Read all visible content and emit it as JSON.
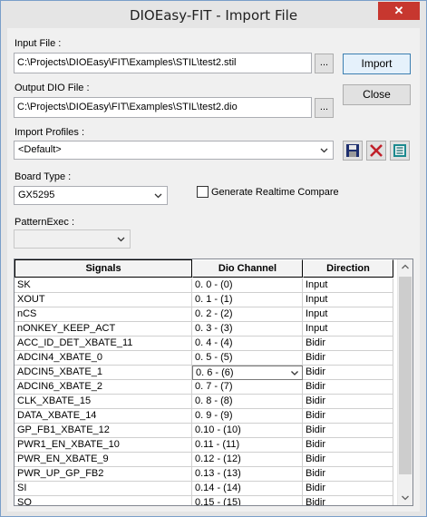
{
  "window": {
    "title": "DIOEasy-FIT - Import File",
    "close_glyph": "✕"
  },
  "input_file": {
    "label": "Input File :",
    "value": "C:\\Projects\\DIOEasy\\FIT\\Examples\\STIL\\test2.stil",
    "browse_label": "..."
  },
  "output_file": {
    "label": "Output DIO File :",
    "value": "C:\\Projects\\DIOEasy\\FIT\\Examples\\STIL\\test2.dio",
    "browse_label": "..."
  },
  "buttons": {
    "import": "Import",
    "close": "Close"
  },
  "profiles": {
    "label": "Import Profiles :",
    "value": "<Default>",
    "icons": [
      "save-icon",
      "delete-icon",
      "profile-list-icon"
    ]
  },
  "board_type": {
    "label": "Board Type :",
    "value": "GX5295"
  },
  "realtime": {
    "label": "Generate Realtime Compare",
    "checked": false
  },
  "pattern_exec": {
    "label": "PatternExec :",
    "value": ""
  },
  "grid": {
    "columns": [
      "Signals",
      "Dio Channel",
      "Direction"
    ],
    "rows": [
      [
        "SK",
        "0. 0 - (0)",
        "Input"
      ],
      [
        "XOUT",
        "0. 1 - (1)",
        "Input"
      ],
      [
        "nCS",
        "0. 2 - (2)",
        "Input"
      ],
      [
        "nONKEY_KEEP_ACT",
        "0. 3 - (3)",
        "Input"
      ],
      [
        "ACC_ID_DET_XBATE_11",
        "0. 4 - (4)",
        "Bidir"
      ],
      [
        "ADCIN4_XBATE_0",
        "0. 5 - (5)",
        "Bidir"
      ],
      [
        "ADCIN5_XBATE_1",
        "0. 6 - (6)",
        "Bidir"
      ],
      [
        "ADCIN6_XBATE_2",
        "0. 7 - (7)",
        "Bidir"
      ],
      [
        "CLK_XBATE_15",
        "0. 8 - (8)",
        "Bidir"
      ],
      [
        "DATA_XBATE_14",
        "0. 9 - (9)",
        "Bidir"
      ],
      [
        "GP_FB1_XBATE_12",
        "0.10 - (10)",
        "Bidir"
      ],
      [
        "PWR1_EN_XBATE_10",
        "0.11 - (11)",
        "Bidir"
      ],
      [
        "PWR_EN_XBATE_9",
        "0.12 - (12)",
        "Bidir"
      ],
      [
        "PWR_UP_GP_FB2",
        "0.13 - (13)",
        "Bidir"
      ],
      [
        "SI",
        "0.14 - (14)",
        "Bidir"
      ],
      [
        "SO",
        "0.15 - (15)",
        "Bidir"
      ]
    ],
    "editing_row": 6
  }
}
